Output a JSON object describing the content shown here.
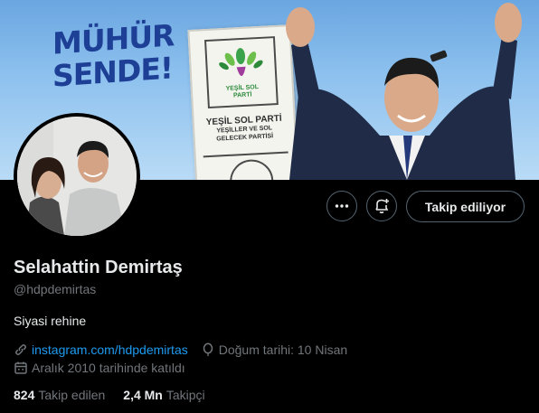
{
  "banner": {
    "slogan_line1": "MÜHÜR",
    "slogan_line2": "SENDE!",
    "ballot_logo_text_1": "YEŞİL SOL",
    "ballot_logo_text_2": "PARTİ",
    "ballot_party_name": "YEŞİL SOL PARTİ",
    "ballot_party_sub_1": "YEŞİLLER VE SOL",
    "ballot_party_sub_2": "GELECEK PARTİSİ"
  },
  "actions": {
    "more_icon": "more-horizontal-icon",
    "notify_icon": "bell-plus-icon",
    "follow_label": "Takip ediliyor"
  },
  "profile": {
    "name": "Selahattin Demirtaş",
    "handle": "@hdpdemirtas",
    "bio": "Siyasi rehine",
    "link": "instagram.com/hdpdemirtas",
    "birthday": "Doğum tarihi: 10 Nisan",
    "joined": "Aralık 2010 tarihinde katıldı"
  },
  "stats": {
    "following_count": "824",
    "following_label": "Takip edilen",
    "followers_count": "2,4 Mn",
    "followers_label": "Takipçi"
  },
  "colors": {
    "accent": "#1d9bf0",
    "muted": "#71767b",
    "text": "#e7e9ea",
    "background": "#000000"
  }
}
